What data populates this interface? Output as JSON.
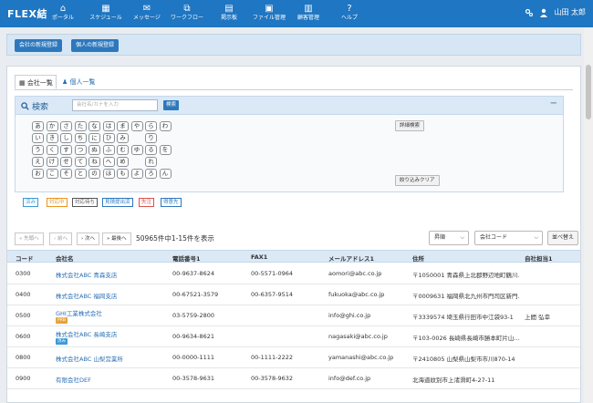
{
  "app": {
    "logo": "FLEX結",
    "user_name": "山田 太郎"
  },
  "nav": {
    "items": [
      {
        "label": "ポータル",
        "icon": "home-icon",
        "glyph": "⌂"
      },
      {
        "label": "スケジュール",
        "icon": "calendar-icon",
        "glyph": "▦"
      },
      {
        "label": "メッセージ",
        "icon": "mail-icon",
        "glyph": "✉"
      },
      {
        "label": "ワークフロー",
        "icon": "workflow-icon",
        "glyph": "⧉"
      },
      {
        "label": "掲示板",
        "icon": "bulletin-icon",
        "glyph": "▤"
      },
      {
        "label": "ファイル管理",
        "icon": "file-icon",
        "glyph": "▣"
      },
      {
        "label": "顧客管理",
        "icon": "customer-icon",
        "glyph": "▥"
      },
      {
        "label": "ヘルプ",
        "icon": "help-icon",
        "glyph": "?"
      }
    ]
  },
  "register": {
    "company_btn": "会社の新規登録",
    "person_btn": "個人の新規登録"
  },
  "tabs": {
    "company": "会社一覧",
    "person": "個人一覧"
  },
  "search": {
    "title": "検索",
    "placeholder": "会社名/カナを入力",
    "button": "検索",
    "advanced": "詳細検索",
    "clear": "絞り込みクリア",
    "kana_rows": [
      [
        "あ",
        "か",
        "さ",
        "た",
        "な",
        "は",
        "ま",
        "や",
        "ら",
        "わ"
      ],
      [
        "い",
        "き",
        "し",
        "ち",
        "に",
        "ひ",
        "み",
        "",
        "り",
        ""
      ],
      [
        "う",
        "く",
        "す",
        "つ",
        "ぬ",
        "ふ",
        "む",
        "ゆ",
        "る",
        "を"
      ],
      [
        "え",
        "け",
        "せ",
        "て",
        "ね",
        "へ",
        "め",
        "",
        "れ",
        ""
      ],
      [
        "お",
        "こ",
        "そ",
        "と",
        "の",
        "ほ",
        "も",
        "よ",
        "ろ",
        "ん"
      ]
    ],
    "statuses": [
      {
        "label": "済み",
        "color": "#3b9ad9"
      },
      {
        "label": "対応中",
        "color": "#e8951f"
      },
      {
        "label": "対応待ち",
        "color": "#555555"
      },
      {
        "label": "見積提出済",
        "color": "#2d78bd"
      },
      {
        "label": "失注",
        "color": "#d9534f"
      },
      {
        "label": "得意先",
        "color": "#2d78bd"
      }
    ]
  },
  "pager": {
    "first": "« 先頭へ",
    "prev": "‹ 前へ",
    "next": "› 次へ",
    "last": "» 最後へ",
    "count_text": "50965件中1-15件を表示",
    "order_select": "昇順",
    "field_select": "会社コード",
    "sort_btn": "並べ替え"
  },
  "table": {
    "headers": [
      "コード",
      "会社名",
      "電話番号1",
      "FAX1",
      "メールアドレス1",
      "住所",
      "自社担当1"
    ],
    "rows": [
      {
        "code": "0300",
        "name": "株式会社ABC 青森支店",
        "badge": "",
        "badge_color": "",
        "tel": "00-9637-8624",
        "fax": "00-5571-0964",
        "mail": "aomori@abc.co.jp",
        "addr": "〒1050001 青森県上北郡野辺地町鶴川...",
        "staff": ""
      },
      {
        "code": "0400",
        "name": "株式会社ABC 福岡支店",
        "badge": "",
        "badge_color": "",
        "tel": "00-67521-3579",
        "fax": "00-6357-9514",
        "mail": "fukuoka@abc.co.jp",
        "addr": "〒0009631 福岡県北九州市門司区新門...",
        "staff": ""
      },
      {
        "code": "0500",
        "name": "GHI工業株式会社",
        "badge": "PRB",
        "badge_color": "#e8a33a",
        "tel": "03-5759-2800",
        "fax": "",
        "mail": "info@ghi.co.jp",
        "addr": "〒3339574 埼玉県行田市中江袋93-1",
        "staff": "上間 弘幸"
      },
      {
        "code": "0600",
        "name": "株式会社ABC 長崎支店",
        "badge": "済み",
        "badge_color": "#3b9ad9",
        "tel": "00-9634-8621",
        "fax": "",
        "mail": "nagasaki@abc.co.jp",
        "addr": "〒103-0026 長崎県長崎市勝本町片山...",
        "staff": ""
      },
      {
        "code": "0800",
        "name": "株式会社ABC 山梨営業所",
        "badge": "",
        "badge_color": "",
        "tel": "00-0000-1111",
        "fax": "00-1111-2222",
        "mail": "yamanashi@abc.co.jp",
        "addr": "〒2410805 山梨県山梨市市川870-14",
        "staff": ""
      },
      {
        "code": "0900",
        "name": "有限会社DEF",
        "badge": "",
        "badge_color": "",
        "tel": "00-3578-9631",
        "fax": "00-3578-9632",
        "mail": "info@def.co.jp",
        "addr": "北海道紋別市上渚滑町4-27-11",
        "staff": ""
      }
    ]
  }
}
